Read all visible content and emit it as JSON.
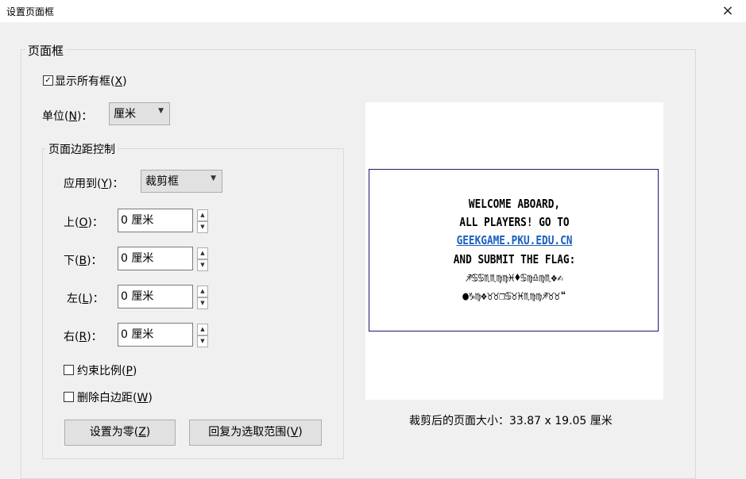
{
  "window": {
    "title": "设置页面框",
    "close_icon": "×"
  },
  "page_box_group": {
    "label": "页面框"
  },
  "show_all": {
    "label": "显示所有框(",
    "mnemonic": "X",
    "suffix": ")",
    "checked_mark": "✓"
  },
  "unit": {
    "label": "单位(",
    "mnemonic": "N",
    "suffix": ")：",
    "value": "厘米"
  },
  "margin_group": {
    "label": "页面边距控制"
  },
  "apply_to": {
    "label": "应用到(",
    "mnemonic": "Y",
    "suffix": ")：",
    "value": "裁剪框"
  },
  "margins": {
    "top": {
      "label": "上(",
      "mnemonic": "O",
      "suffix": ")：",
      "value": "0 厘米"
    },
    "bottom": {
      "label": "下(",
      "mnemonic": "B",
      "suffix": ")：",
      "value": "0 厘米"
    },
    "left": {
      "label": "左(",
      "mnemonic": "L",
      "suffix": ")：",
      "value": "0 厘米"
    },
    "right": {
      "label": "右(",
      "mnemonic": "R",
      "suffix": ")：",
      "value": "0 厘米"
    }
  },
  "constrain": {
    "label": "约束比例(",
    "mnemonic": "P",
    "suffix": ")"
  },
  "remove_white": {
    "label": "删除白边距(",
    "mnemonic": "W",
    "suffix": ")"
  },
  "buttons": {
    "set_zero": {
      "label": "设置为零(",
      "mnemonic": "Z",
      "suffix": ")"
    },
    "revert": {
      "label": "回复为选取范围(",
      "mnemonic": "V",
      "suffix": ")"
    }
  },
  "preview": {
    "lines": [
      "WELCOME ABOARD,",
      "ALL PLAYERS! GO TO",
      "GEEKGAME.PKU.EDU.CN",
      "AND SUBMIT THE FLAG:",
      "♐♋♋♏♏♍♍♓♦♋♍♎♍♏❖✍",
      "●♑♍❖♉♉❐♋♉♓♏♍♍♐♉♉❝"
    ],
    "size_label": "裁剪后的页面大小：33.87 x 19.05 厘米"
  },
  "icons": {
    "spin_up": "▲",
    "spin_down": "▼",
    "dropdown": "▼"
  }
}
